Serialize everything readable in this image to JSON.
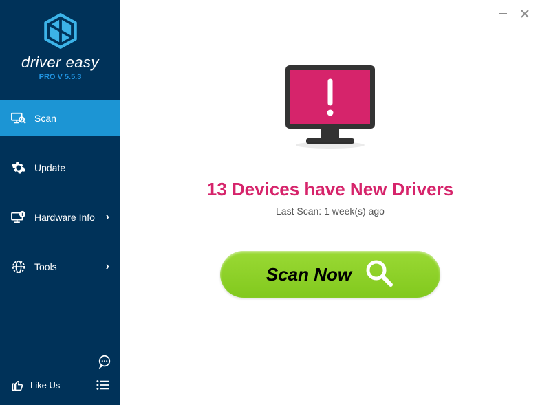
{
  "app": {
    "name": "driver easy",
    "version": "PRO V 5.5.3"
  },
  "sidebar": {
    "items": [
      {
        "label": "Scan"
      },
      {
        "label": "Update"
      },
      {
        "label": "Hardware Info"
      },
      {
        "label": "Tools"
      }
    ],
    "like": "Like Us"
  },
  "main": {
    "headline": "13 Devices have New Drivers",
    "subline": "Last Scan: 1 week(s) ago",
    "scan_button": "Scan Now"
  }
}
